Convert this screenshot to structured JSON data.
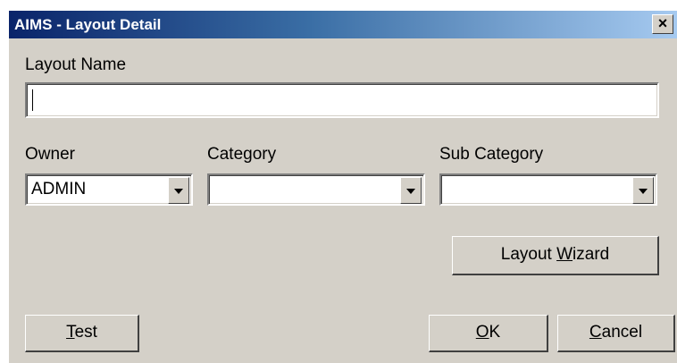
{
  "window": {
    "title": "AIMS - Layout Detail",
    "close_label": "×"
  },
  "form": {
    "layout_name_label": "Layout Name",
    "layout_name_value": "",
    "owner_label": "Owner",
    "owner_value": "ADMIN",
    "category_label": "Category",
    "category_value": "",
    "subcategory_label": "Sub Category",
    "subcategory_value": ""
  },
  "buttons": {
    "wizard": {
      "pre": "Layout ",
      "mnemonic": "W",
      "post": "izard"
    },
    "test": {
      "pre": "",
      "mnemonic": "T",
      "post": "est"
    },
    "ok": {
      "pre": "",
      "mnemonic": "O",
      "post": "K"
    },
    "cancel": {
      "pre": "",
      "mnemonic": "C",
      "post": "ancel"
    }
  },
  "icons": {
    "close": "close-icon",
    "dropdown": "chevron-down-icon"
  }
}
